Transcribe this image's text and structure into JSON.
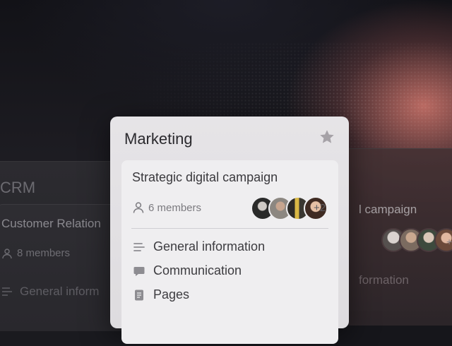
{
  "main_card": {
    "title": "Marketing",
    "project_title": "Strategic digital campaign",
    "members_label": "6 members",
    "more_count": "+2",
    "menu": [
      {
        "label": "General information",
        "icon": "lines-icon"
      },
      {
        "label": "Communication",
        "icon": "chat-icon"
      },
      {
        "label": "Pages",
        "icon": "page-icon"
      }
    ]
  },
  "left_card": {
    "title": "CRM",
    "project_title": "Customer Relation",
    "members_label": "8 members",
    "menu_item": "General inform"
  },
  "right_card": {
    "project_title": "l campaign",
    "menu_item": "formation",
    "more_count": "+"
  }
}
